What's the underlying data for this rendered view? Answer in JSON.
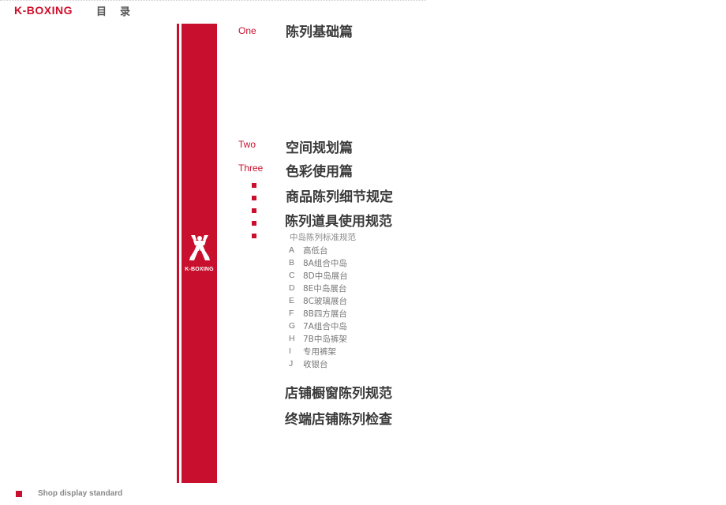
{
  "header": {
    "brand": "K-BOXING",
    "heading": "目录"
  },
  "logo": {
    "text": "K-BOXING"
  },
  "sections": [
    {
      "num": "One",
      "title": "陈列基础篇"
    },
    {
      "num": "Two",
      "title": "空间规划篇"
    },
    {
      "num": "Three",
      "title": "色彩使用篇"
    }
  ],
  "bullet_sections": [
    {
      "title": "商品陈列细节规定"
    },
    {
      "title": "陈列道具使用规范"
    }
  ],
  "sub_section": {
    "heading": "中岛陈列标准规范",
    "items": [
      {
        "letter": "A",
        "label": "高低台"
      },
      {
        "letter": "B",
        "label": "8A组合中岛"
      },
      {
        "letter": "C",
        "label": "8D中岛展台"
      },
      {
        "letter": "D",
        "label": "8E中岛展台"
      },
      {
        "letter": "E",
        "label": "8C玻璃展台"
      },
      {
        "letter": "F",
        "label": "8B四方展台"
      },
      {
        "letter": "G",
        "label": "7A组合中岛"
      },
      {
        "letter": "H",
        "label": "7B中岛裤架"
      },
      {
        "letter": "I",
        "label": "专用裤架"
      },
      {
        "letter": "J",
        "label": "收银台"
      }
    ]
  },
  "extra_sections": [
    {
      "title": "店铺橱窗陈列规范"
    },
    {
      "title": "终端店铺陈列检查"
    }
  ],
  "footer": {
    "text": "Shop display standard"
  },
  "colors": {
    "brand_red": "#c8102e",
    "title_gray": "#3a3a3a",
    "sub_gray": "#777777"
  }
}
